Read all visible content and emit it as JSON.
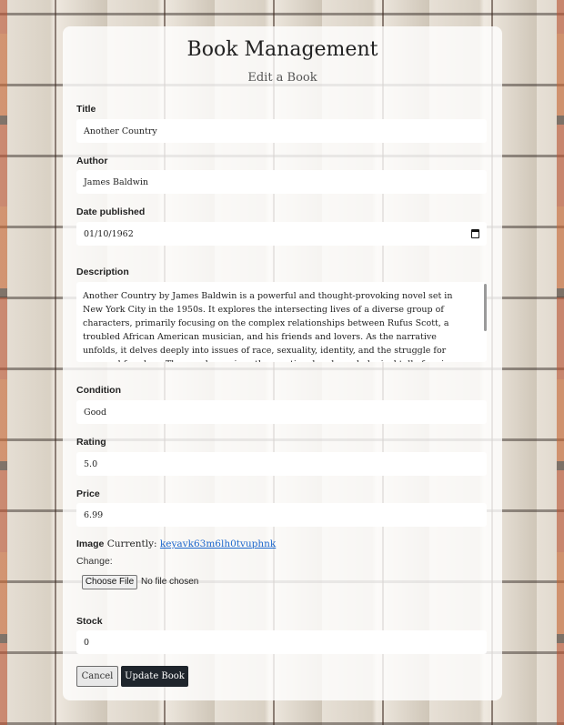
{
  "header": {
    "title": "Book Management",
    "subtitle": "Edit a Book"
  },
  "form": {
    "title": {
      "label": "Title",
      "value": "Another Country"
    },
    "author": {
      "label": "Author",
      "value": "James Baldwin"
    },
    "date_published": {
      "label": "Date published",
      "value": "01/10/1962"
    },
    "description": {
      "label": "Description",
      "value": "Another Country by James Baldwin is a powerful and thought-provoking novel set in New York City in the 1950s. It explores the intersecting lives of a diverse group of characters, primarily focusing on the complex relationships between Rufus Scott, a troubled African American musician, and his friends and lovers. As the narrative unfolds, it delves deeply into issues of race, sexuality, identity, and the struggle for personal freedom. The novel examines the emotional and psychological toll of racism, homophobia, and societal expectations on the characters."
    },
    "condition": {
      "label": "Condition",
      "value": "Good"
    },
    "rating": {
      "label": "Rating",
      "value": "5.0"
    },
    "price": {
      "label": "Price",
      "value": "6.99"
    },
    "image": {
      "label": "Image",
      "currently_text": "Currently:",
      "current_file": "keyavk63m6lh0tvuphnk",
      "change_label": "Change:",
      "choose_button": "Choose File",
      "file_status": "No file chosen"
    },
    "stock": {
      "label": "Stock",
      "value": "0"
    }
  },
  "actions": {
    "cancel_label": "Cancel",
    "update_label": "Update Book"
  },
  "colors": {
    "panel_background": "#ffffffcc",
    "link": "#1a66cc",
    "primary_button": "#1f252c"
  },
  "icons": {
    "date_picker": "calendar-icon"
  }
}
